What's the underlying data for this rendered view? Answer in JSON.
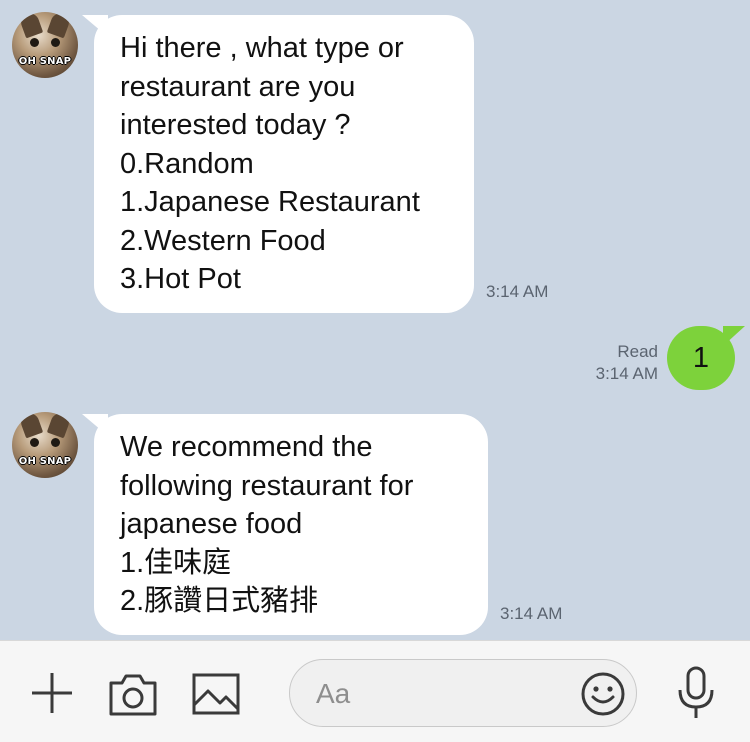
{
  "messages": {
    "first": {
      "avatar_caption": "OH SNAP",
      "lines": [
        "Hi there , what type or",
        "restaurant are you",
        "interested today ?",
        "0.Random",
        "1.Japanese Restaurant",
        "2.Western Food",
        "3.Hot Pot"
      ],
      "time": "3:14 AM"
    },
    "reply": {
      "text": "1",
      "status": "Read",
      "time": "3:14 AM"
    },
    "second": {
      "avatar_caption": "OH SNAP",
      "lines": [
        "We recommend the",
        "following restaurant for",
        "japanese food",
        "1.佳味庭",
        "2.豚讚日式豬排"
      ],
      "time": "3:14 AM"
    }
  },
  "composer": {
    "placeholder": "Aa",
    "icons": [
      "plus-icon",
      "camera-icon",
      "image-icon",
      "emoji-icon",
      "microphone-icon"
    ]
  },
  "colors": {
    "background": "#cbd6e3",
    "incoming_bubble": "#ffffff",
    "outgoing_bubble": "#7dd23b"
  }
}
